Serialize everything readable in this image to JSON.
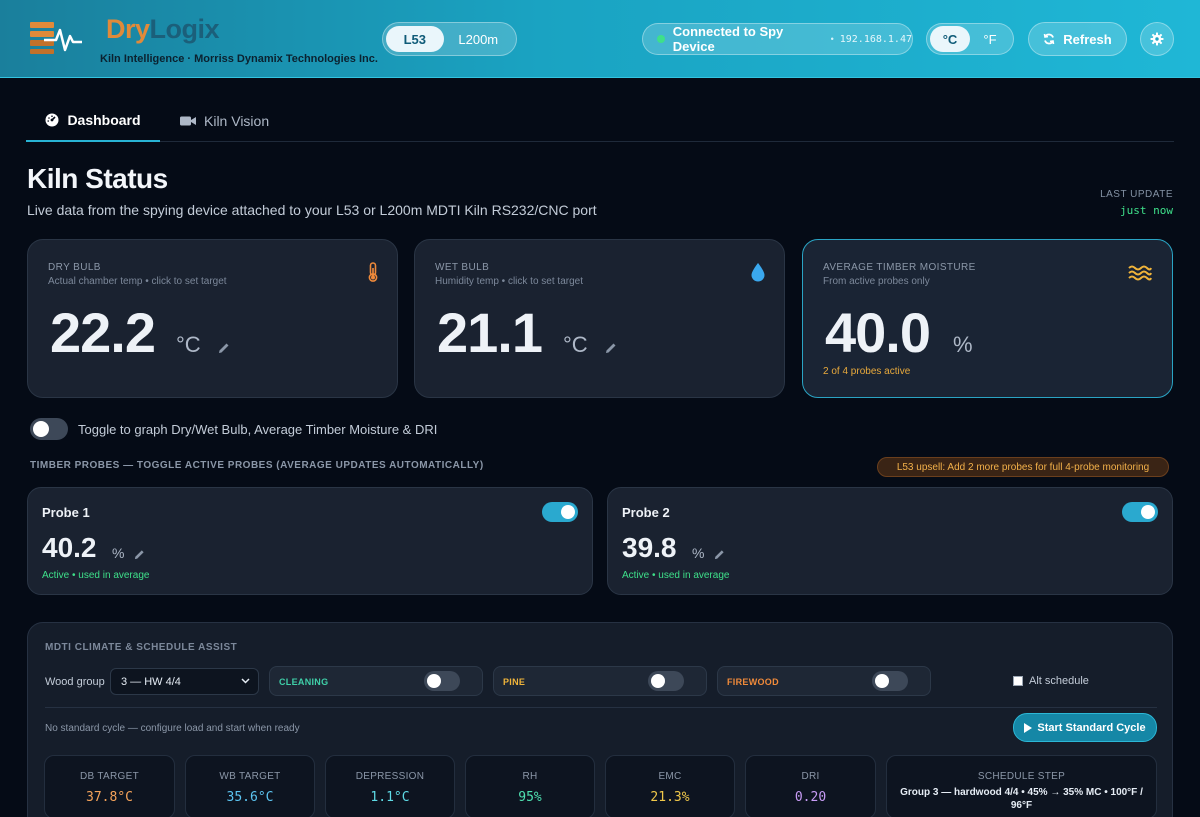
{
  "header": {
    "brand_dry": "Dry",
    "brand_logix": "Logix",
    "tagline": "Kiln Intelligence · Morriss Dynamix Technologies Inc.",
    "models": [
      "L53",
      "L200m"
    ],
    "connection_text": "Connected to Spy Device",
    "connection_sep": "•",
    "connection_ip": "192.168.1.47",
    "units": [
      "°C",
      "°F"
    ],
    "refresh_label": "Refresh"
  },
  "tabs": {
    "dashboard": "Dashboard",
    "kiln_vision": "Kiln Vision"
  },
  "page": {
    "title": "Kiln Status",
    "subtitle": "Live data from the spying device attached to your L53 or L200m MDTI Kiln RS232/CNC port",
    "last_update_label": "LAST UPDATE",
    "last_update_value": "just now"
  },
  "cards": {
    "dry_bulb": {
      "label": "DRY BULB",
      "hint": "Actual chamber temp • click to set target",
      "value": "22.2",
      "unit": "°C"
    },
    "wet_bulb": {
      "label": "WET BULB",
      "hint": "Humidity temp • click to set target",
      "value": "21.1",
      "unit": "°C"
    },
    "moisture": {
      "label": "AVERAGE TIMBER MOISTURE",
      "hint": "From active probes only",
      "value": "40.0",
      "unit": "%",
      "footer": "2 of 4 probes active"
    }
  },
  "graph_toggle_label": "Toggle to graph Dry/Wet Bulb, Average Timber Moisture & DRI",
  "probes": {
    "heading": "TIMBER PROBES — TOGGLE ACTIVE PROBES (AVERAGE UPDATES AUTOMATICALLY)",
    "upsell": "L53 upsell: Add 2 more probes for full 4-probe monitoring",
    "items": [
      {
        "name": "Probe 1",
        "value": "40.2",
        "unit": "%",
        "status": "Active • used in average"
      },
      {
        "name": "Probe 2",
        "value": "39.8",
        "unit": "%",
        "status": "Active • used in average"
      }
    ]
  },
  "schedule": {
    "title": "MDTI CLIMATE & SCHEDULE ASSIST",
    "wood_group_label": "Wood group",
    "wood_group_value": "3 — HW 4/4",
    "modes": {
      "cleaning": "CLEANING",
      "pine": "PINE",
      "firewood": "FIREWOOD"
    },
    "alt_schedule_label": "Alt schedule",
    "no_cycle_text": "No standard cycle — configure load and start when ready",
    "start_label": "Start Standard Cycle",
    "metrics": [
      {
        "name": "DB TARGET",
        "value": "37.8°C",
        "color": "#f5a35a"
      },
      {
        "name": "WB TARGET",
        "value": "35.6°C",
        "color": "#5cc4f0"
      },
      {
        "name": "DEPRESSION",
        "value": "1.1°C",
        "color": "#5fdbe6"
      },
      {
        "name": "RH",
        "value": "95%",
        "color": "#4fe0b0"
      },
      {
        "name": "EMC",
        "value": "21.3%",
        "color": "#f0c84a"
      },
      {
        "name": "DRI",
        "value": "0.20",
        "color": "#c89cf5"
      }
    ],
    "step_name": "SCHEDULE STEP",
    "step_text": "Group 3 — hardwood 4/4 • 45% → 35% MC • 100°F / 96°F"
  }
}
